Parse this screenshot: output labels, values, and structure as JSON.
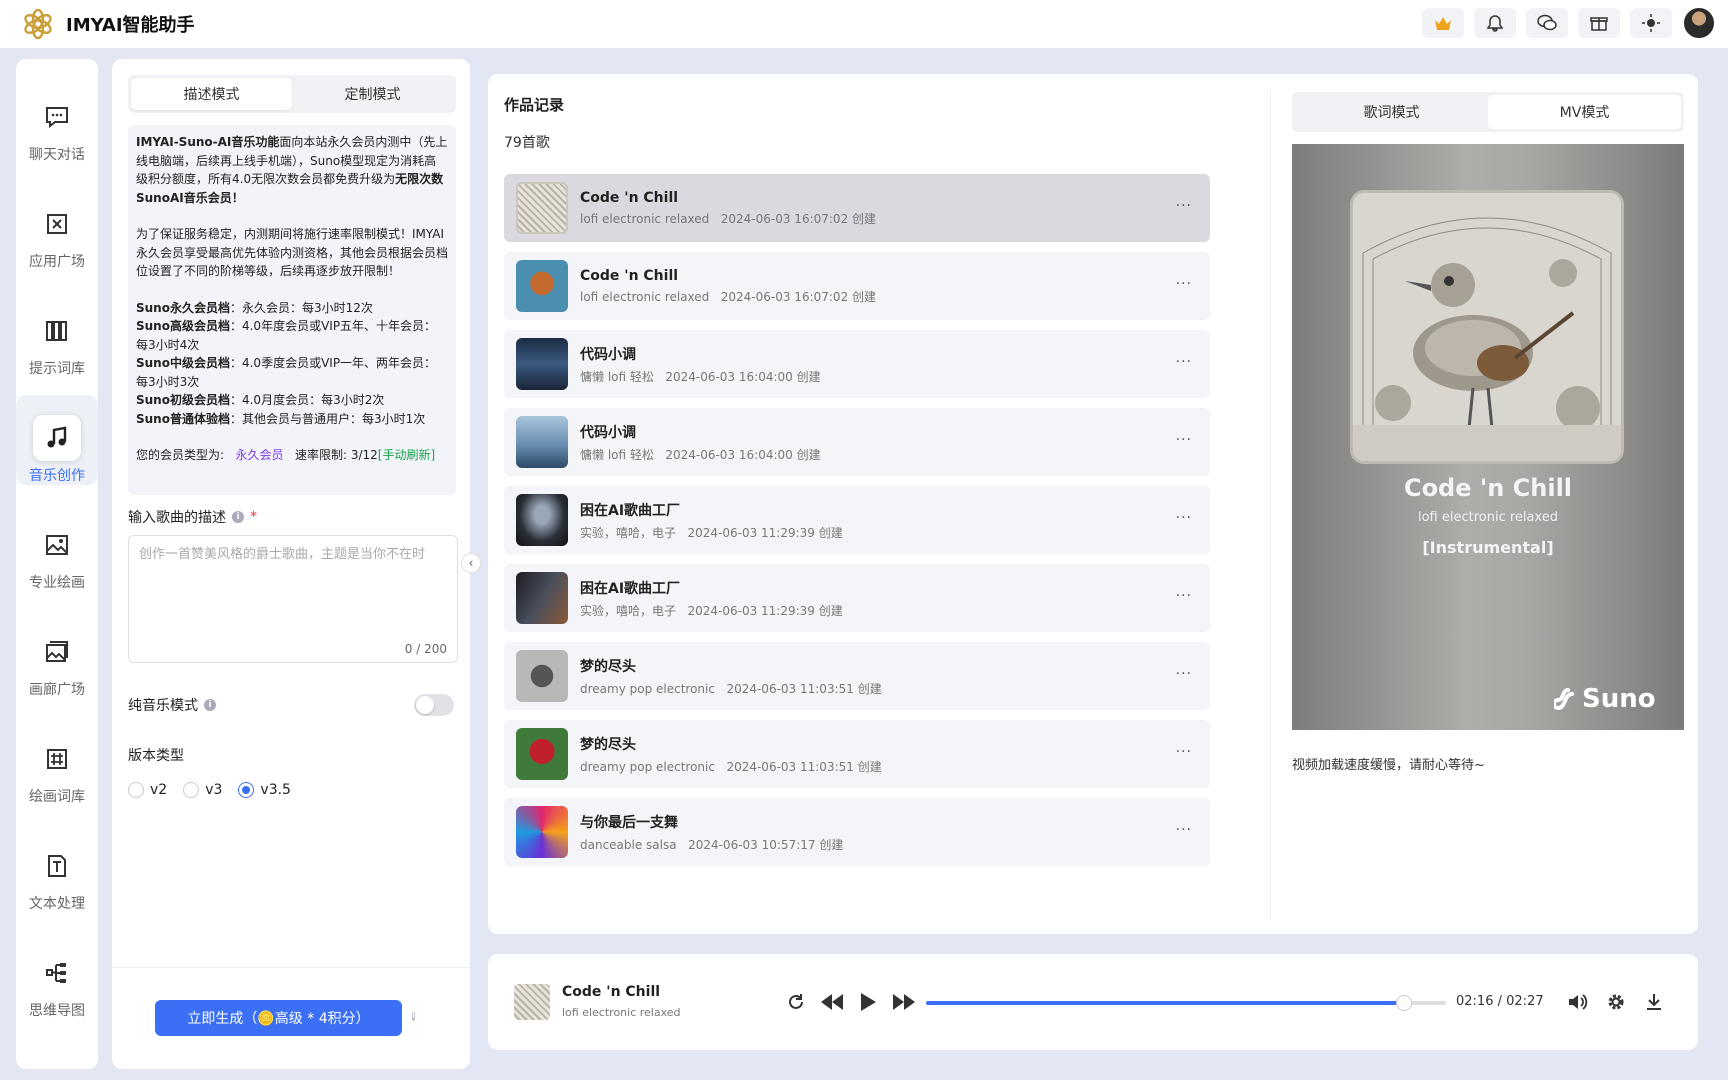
{
  "app": {
    "title": "IMYAI智能助手"
  },
  "nav": {
    "items": [
      {
        "label": "聊天对话",
        "icon": "chat-icon"
      },
      {
        "label": "应用广场",
        "icon": "app-icon"
      },
      {
        "label": "提示词库",
        "icon": "book-icon"
      },
      {
        "label": "音乐创作",
        "icon": "music-icon",
        "active": true
      },
      {
        "label": "专业绘画",
        "icon": "image-icon"
      },
      {
        "label": "画廊广场",
        "icon": "gallery-icon"
      },
      {
        "label": "绘画词库",
        "icon": "hash-icon"
      },
      {
        "label": "文本处理",
        "icon": "text-icon"
      },
      {
        "label": "思维导图",
        "icon": "mindmap-icon"
      }
    ]
  },
  "left": {
    "tabs": [
      "描述模式",
      "定制模式"
    ],
    "notice": {
      "p1_bold": "IMYAI-Suno-AI音乐功能",
      "p1_text": "面向本站永久会员内测中（先上线电脑端，后续再上线手机端），Suno模型现定为消耗高级积分额度，所有4.0无限次数会员都免费升级为",
      "p1_bold2": "无限次数SunoAI音乐会员！",
      "p2": "为了保证服务稳定，内测期间将施行速率限制模式！IMYAI永久会员享受最高优先体验内测资格，其他会员根据会员档位设置了不同的阶梯等级，后续再逐步放开限制！",
      "tiers": [
        {
          "name": "Suno永久会员档",
          "desc": "：永久会员：每3小时12次"
        },
        {
          "name": "Suno高级会员档",
          "desc": "：4.0年度会员或VIP五年、十年会员：每3小时4次"
        },
        {
          "name": "Suno中级会员档",
          "desc": "：4.0季度会员或VIP一年、两年会员：每3小时3次"
        },
        {
          "name": "Suno初级会员档",
          "desc": "：4.0月度会员：每3小时2次"
        },
        {
          "name": "Suno普通体验档",
          "desc": "：其他会员与普通用户：每3小时1次"
        }
      ],
      "member_label": "您的会员类型为:",
      "member_type": "永久会员",
      "rate_label": "速率限制: 3/12",
      "refresh": "[手动刷新]"
    },
    "desc_label": "输入歌曲的描述",
    "desc_placeholder": "创作一首赞美风格的爵士歌曲，主题是当你不在时",
    "desc_count": "0 / 200",
    "instrumental_label": "纯音乐模式",
    "version_label": "版本类型",
    "versions": [
      "v2",
      "v3",
      "v3.5"
    ],
    "version_selected": "v3.5",
    "generate_label": "立即生成（🪙高级 * 4积分）"
  },
  "works": {
    "title": "作品记录",
    "count": "79首歌",
    "songs": [
      {
        "title": "Code 'n Chill",
        "style": "lofi electronic relaxed",
        "time": "2024-06-03 16:07:02 创建",
        "cover": "bird-sketch"
      },
      {
        "title": "Code 'n Chill",
        "style": "lofi electronic relaxed",
        "time": "2024-06-03 16:07:02 创建",
        "cover": "bird-color"
      },
      {
        "title": "代码小调",
        "style": "慵懒 lofi 轻松",
        "time": "2024-06-03 16:04:00 创建",
        "cover": "night-sky"
      },
      {
        "title": "代码小调",
        "style": "慵懒 lofi 轻松",
        "time": "2024-06-03 16:04:00 创建",
        "cover": "mountain"
      },
      {
        "title": "困在AI歌曲工厂",
        "style": "实验，嘻哈，电子",
        "time": "2024-06-03 11:29:39 创建",
        "cover": "factory"
      },
      {
        "title": "困在AI歌曲工厂",
        "style": "实验，嘻哈，电子",
        "time": "2024-06-03 11:29:39 创建",
        "cover": "factory-dark"
      },
      {
        "title": "梦的尽头",
        "style": "dreamy pop electronic",
        "time": "2024-06-03 11:03:51 创建",
        "cover": "heart-gray"
      },
      {
        "title": "梦的尽头",
        "style": "dreamy pop electronic",
        "time": "2024-06-03 11:03:51 创建",
        "cover": "heart-red"
      },
      {
        "title": "与你最后一支舞",
        "style": "danceable salsa",
        "time": "2024-06-03 10:57:17 创建",
        "cover": "disco"
      }
    ],
    "more": "···"
  },
  "right": {
    "tabs": [
      "歌词模式",
      "MV模式"
    ],
    "mv_title": "Code 'n Chill",
    "mv_style": "lofi electronic relaxed",
    "mv_tag": "[Instrumental]",
    "mv_brand": "Suno",
    "note": "视频加载速度缓慢，请耐心等待~"
  },
  "player": {
    "title": "Code 'n Chill",
    "style": "lofi electronic relaxed",
    "current": "02:16",
    "sep": "/",
    "total": "02:27",
    "progress": 0.92
  },
  "colors": {
    "accent": "#3b6ff5",
    "member": "#7c3aed",
    "refresh": "#16a34a"
  }
}
